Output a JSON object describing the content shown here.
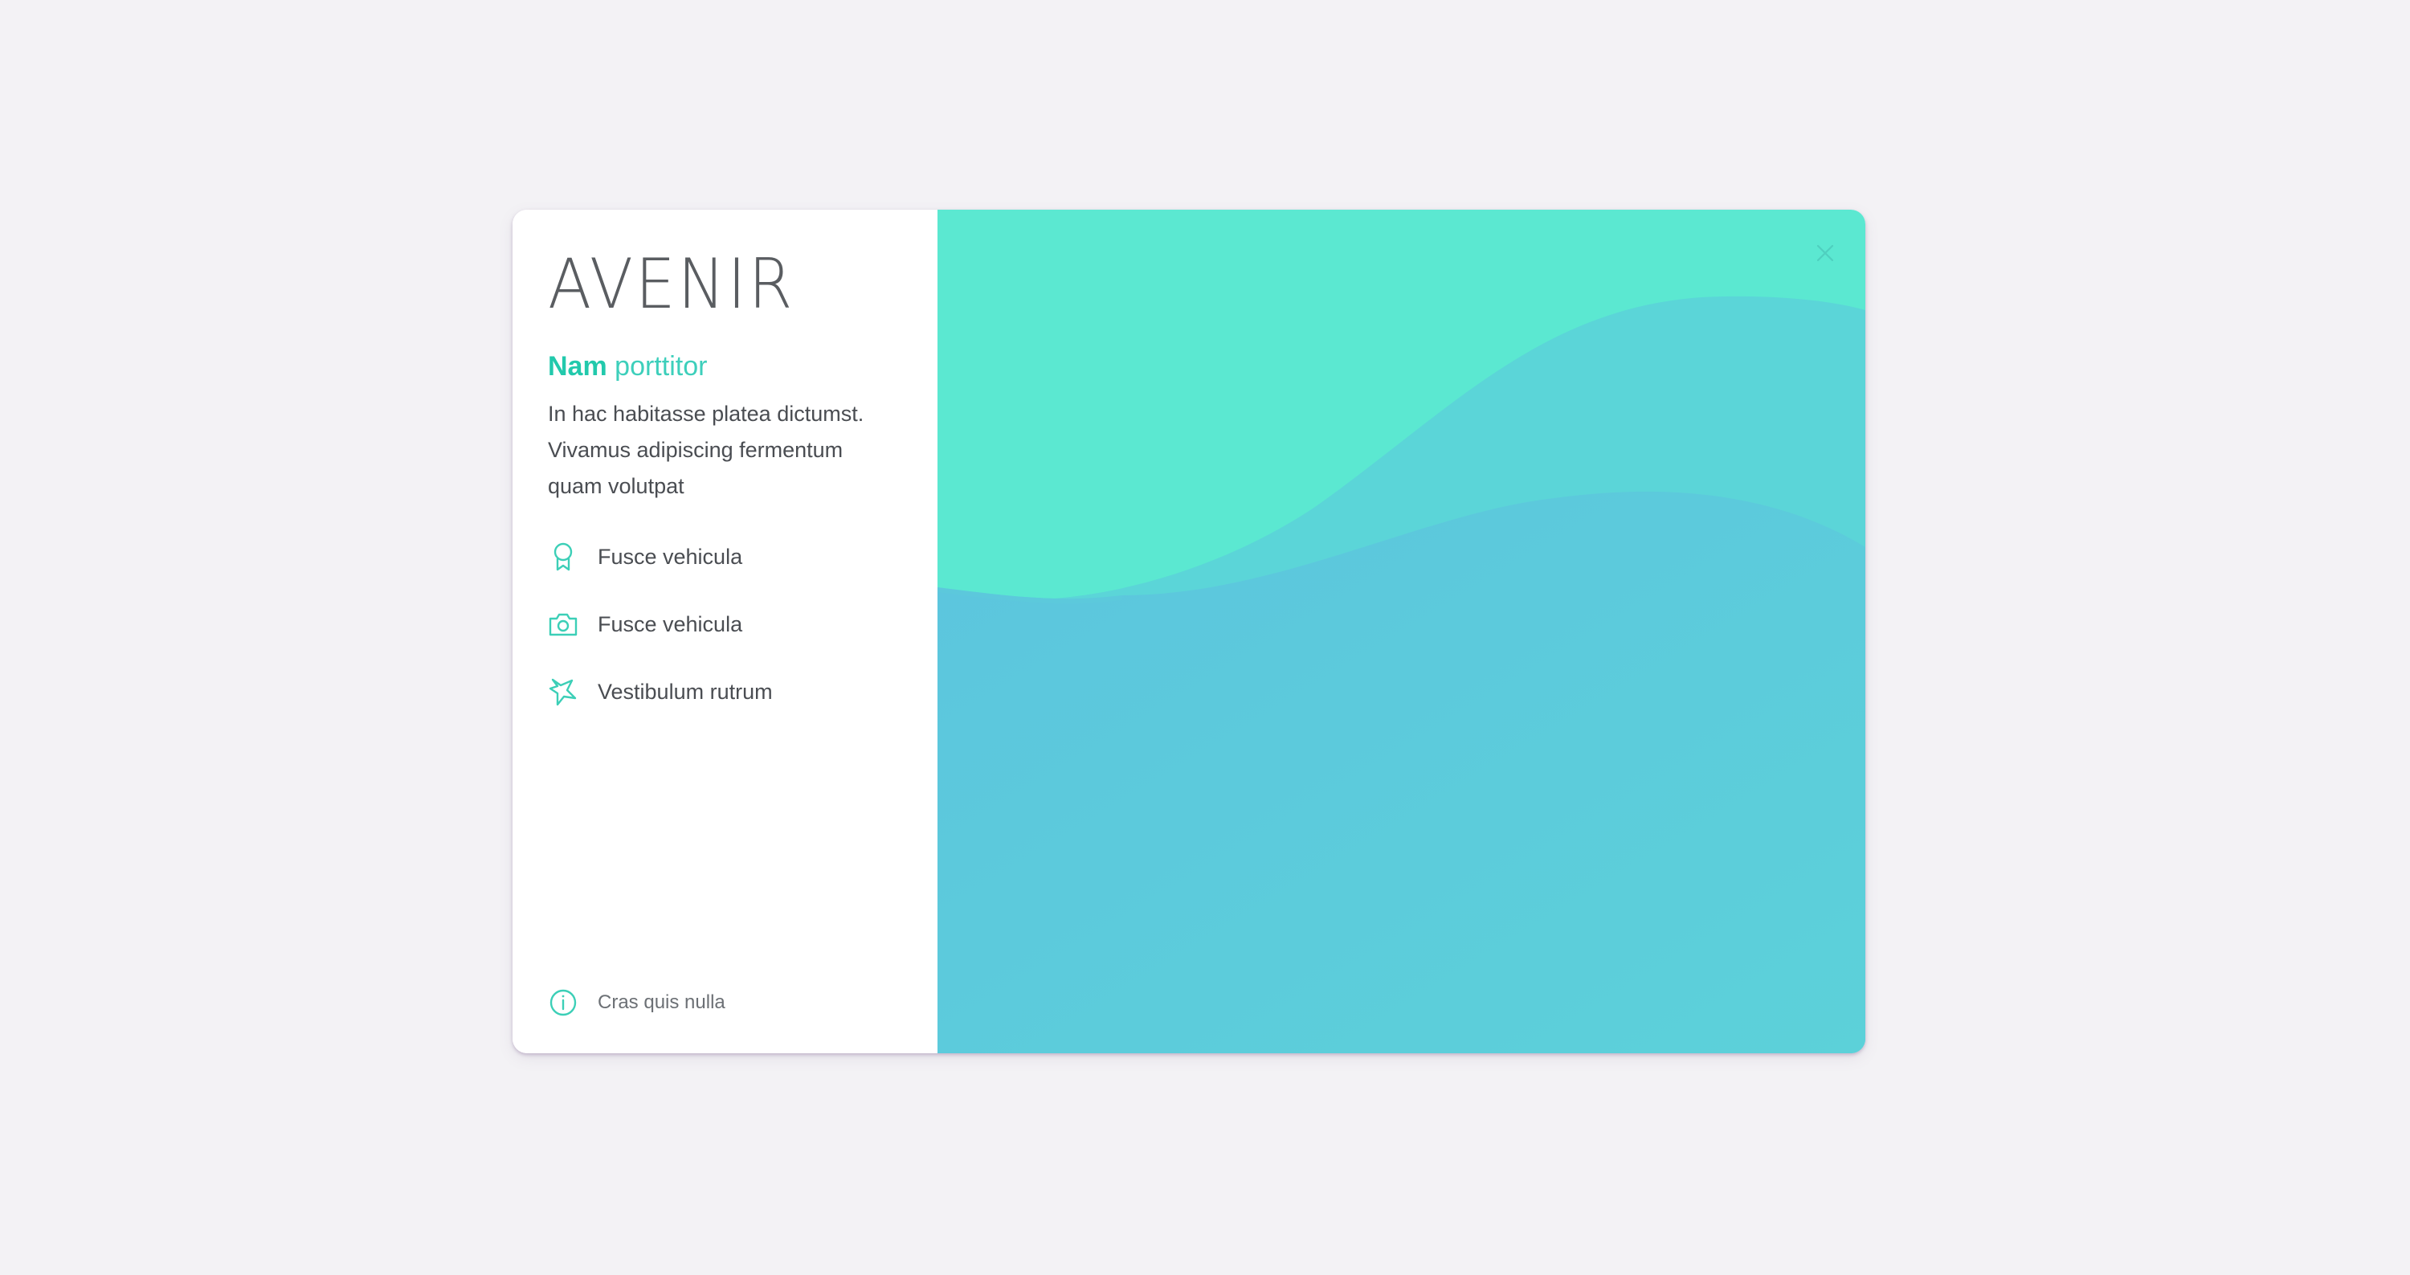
{
  "brand": {
    "title": "AVENIR"
  },
  "headline": {
    "bold": "Nam",
    "rest": "porttitor"
  },
  "description": "In hac habitasse platea dictumst. Vivamus adipiscing fermentum quam volutpat",
  "features": [
    {
      "icon": "award-ribbon-icon",
      "label": "Fusce vehicula"
    },
    {
      "icon": "camera-icon",
      "label": "Fusce vehicula"
    },
    {
      "icon": "star-icon",
      "label": "Vestibulum rutrum"
    }
  ],
  "footer": {
    "icon": "info-icon",
    "label": "Cras quis nulla"
  },
  "close": {
    "icon": "close-icon"
  },
  "colors": {
    "background": "#f3f2f5",
    "accent": "#22c9ac",
    "wave_top": "#5be7d1",
    "wave_middle": "#5bd4d8",
    "wave_bottom": "#5cc6dd"
  }
}
